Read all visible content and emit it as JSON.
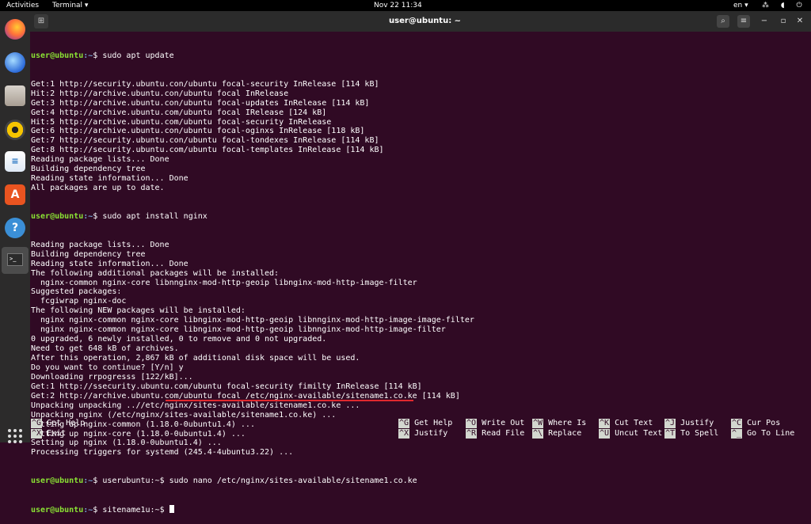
{
  "topbar": {
    "activities": "Activities",
    "app_menu": "Terminal ▾",
    "clock": "Nov 22  11:34",
    "language": "en ▾",
    "tray": "⁂ ◖ ⏻ ▾"
  },
  "dock": {
    "items": [
      "Firefox",
      "Thunderbird",
      "Files",
      "Rhythmbox",
      "Writer",
      "Software",
      "Help",
      "Terminal"
    ],
    "terminal_glyph": ">_"
  },
  "window": {
    "title": "user@ubuntu: ~",
    "new_tab_glyph": "⊞",
    "search_glyph": "⌕",
    "menu_glyph": "≡",
    "min_glyph": "−",
    "max_glyph": "▫",
    "close_glyph": "✕"
  },
  "terminal": {
    "prompt_user": "user@ubuntu",
    "prompt_path": ":~",
    "cmd1": "$ sudo apt update",
    "cmd2": "$ sudo apt install nginx",
    "cmd3_prompt_user": "user@ubuntu",
    "cmd3_path": ":~",
    "cmd3": "$ userubuntu:~$ sudo nano /etc/nginx/sites-available/sitename1.co.ke",
    "cmd4_prompt_user": "user@ubuntu",
    "cmd4_path": ":~",
    "cmd4": "$ sitename1u:~$ ",
    "lines_block1": [
      "Get:1 http://security.ubuntu.con/ubuntu focal-security InRelease [114 kB]",
      "Hit:2 http://archive.ubuntu.con/ubuntu focal InRelease",
      "Get:3 http://archive.ubuntu.con/ubuntu focal-updates InRelease [114 kB]",
      "Get:4 http://archive.ubuntu.com/ubuntu focal IRelease [124 kB]",
      "Hit:5 http://archive.ubuntu.com/ubuntu focal-security InRelease",
      "Get:6 http://archive.ubuntu.con/ubuntu focal-oginxs InRelease [118 kB]",
      "Get:7 http://security.ubuntu.con/ubuntu focal-tondexes InRelease [114 kB]",
      "Get:8 http://security.ubuntu.com/ubuntu focal-templates InRelease [114 kB]",
      "Reading package lists... Done",
      "Building dependency tree",
      "Reading state information... Done",
      "All packages are up to date."
    ],
    "lines_block2": [
      "Reading package lists... Done",
      "Building dependency tree",
      "Reading state information... Done",
      "The following additional packages will be installed:",
      "  nginx-common nginx-core libnnginx-mod-http-geoip libnginx-mod-http-image-filter",
      "Suggested packages:",
      "  fcgiwrap nginx-doc",
      "The following NEW packages will be installed:",
      "  nginx nginx-common nginx-core libnginx-mod-http-geoip libnnginx-mod-http-image-image-filter",
      "  nginx nginx-common nginx-core libnginx-mod-http-geoip libnnginx-mod-http-image-filter",
      "0 upgraded, 6 newly installed, 0 to remove and 0 not upgraded.",
      "Need to get 648 kB of archives.",
      "After this operation, 2,867 kB of additional disk space will be used.",
      "Do you want to continue? [Y/n] y",
      "Downloading rrpogresss [122/kB]...",
      "Get:1 http://ssecurity.ubuntu.com/ubuntu focal-security fimilty InRelease [114 kB]",
      "Get:2 http://archive.ubuntu.com/ubuntu focal /etc/nginx-available/sitename1.co.ke [114 kB]",
      "Unpacking unpacking ..//etc/nginx/sites-available/sitename1.co.ke ...",
      "Unpacking nginx (/etc/nginx/sites-available/sitename1.co.ke) ...",
      "Setting up nginx-common (1.18.0-0ubuntu1.4) ...",
      "Setting up nginx-core (1.18.0-0ubuntu1.4) ...",
      "Setting up nginx (1.18.0-0ubuntu1.4) ...",
      "Processing triggers for systemd (245.4-4ubuntu3.22) ..."
    ]
  },
  "nano_shortcuts": [
    {
      "k1": "^G",
      "l1": "Get Help",
      "k2": "^X",
      "l2": "Exit"
    },
    {
      "k1": "^G",
      "l1": "Get Help",
      "k2": "^X",
      "l2": "Justify"
    },
    {
      "k1": "^O",
      "l1": "Write Out",
      "k2": "^R",
      "l2": "Read File"
    },
    {
      "k1": "^W",
      "l1": "Where Is",
      "k2": "^\\",
      "l2": "Replace"
    },
    {
      "k1": "^K",
      "l1": "Cut Text",
      "k2": "^U",
      "l2": "Uncut Text"
    },
    {
      "k1": "^J",
      "l1": "Justify",
      "k2": "^T",
      "l2": "To Spell"
    },
    {
      "k1": "^C",
      "l1": "Cur Pos",
      "k2": "^_",
      "l2": "Go To Line"
    }
  ],
  "colors": {
    "terminal_bg": "#300a24",
    "prompt_user": "#8ae234",
    "prompt_path": "#729fcf",
    "highlight_underline": "#e0282e"
  }
}
